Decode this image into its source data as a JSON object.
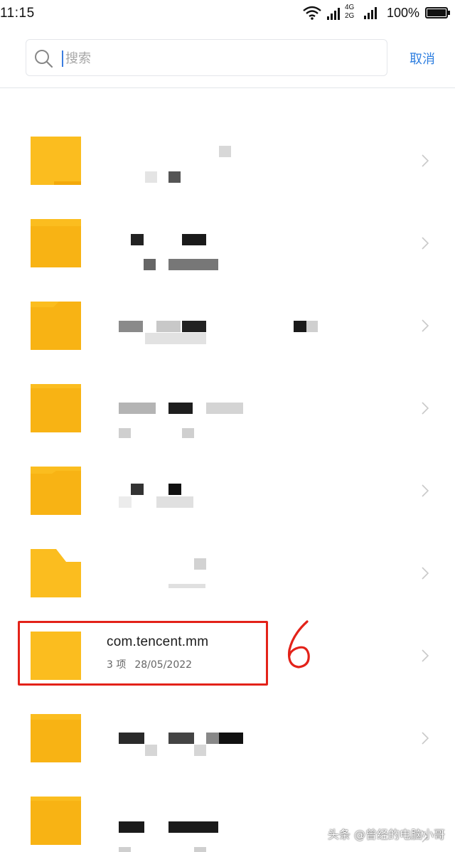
{
  "status_bar": {
    "time": "11:15",
    "network_label_top": "4G",
    "network_label_bottom": "2G",
    "battery_percent": "100%",
    "icons": [
      "wifi-icon",
      "cellular-signal-icon",
      "battery-icon"
    ]
  },
  "search": {
    "placeholder": "搜索",
    "value": "",
    "cancel_label": "取消",
    "accent_color": "#2f7fe0"
  },
  "file_list": {
    "folder_color": "#fbbd1f",
    "highlighted_item": {
      "name": "com.tencent.mm",
      "count": "3 项",
      "date": "28/05/2022"
    }
  },
  "annotation": {
    "label": "6",
    "color": "#e32219"
  },
  "watermark": "头条 @曾经的电脑小哥"
}
